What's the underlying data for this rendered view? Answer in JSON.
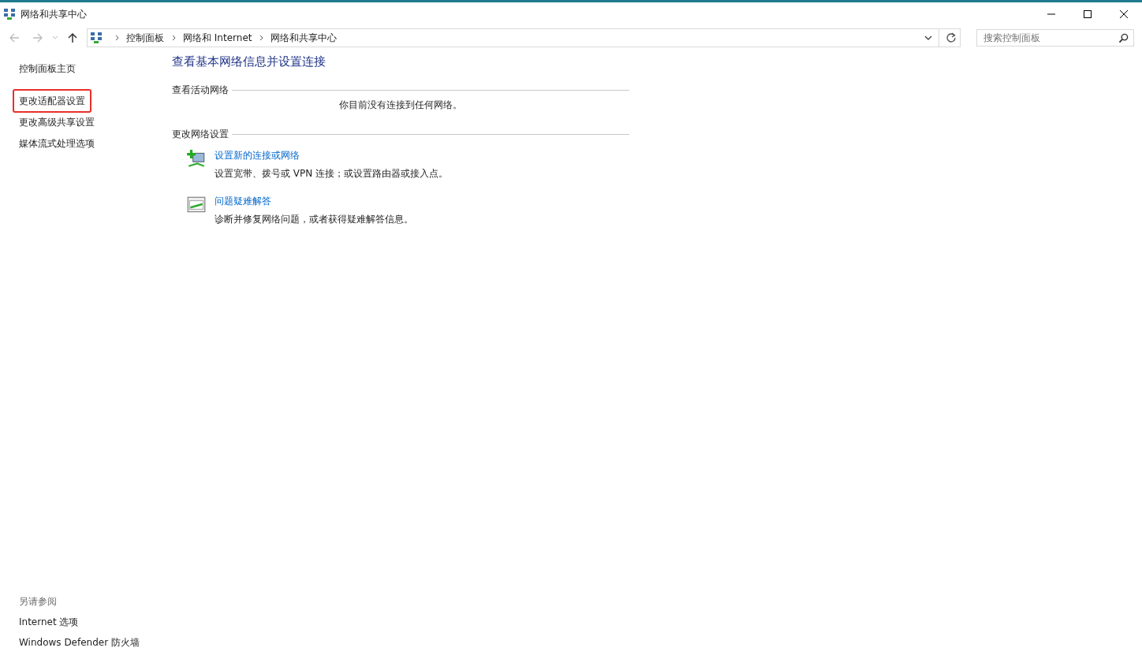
{
  "window": {
    "title": "网络和共享中心"
  },
  "address_bar": {
    "breadcrumbs": [
      "控制面板",
      "网络和 Internet",
      "网络和共享中心"
    ]
  },
  "search": {
    "placeholder": "搜索控制面板"
  },
  "sidebar": {
    "items": [
      {
        "label": "控制面板主页",
        "highlighted": false
      },
      {
        "label": "更改适配器设置",
        "highlighted": true
      },
      {
        "label": "更改高级共享设置",
        "highlighted": false
      },
      {
        "label": "媒体流式处理选项",
        "highlighted": false
      }
    ],
    "see_also": {
      "heading": "另请参阅",
      "links": [
        "Internet 选项",
        "Windows Defender 防火墙"
      ]
    }
  },
  "main": {
    "title": "查看基本网络信息并设置连接",
    "active_networks": {
      "heading": "查看活动网络",
      "message": "你目前没有连接到任何网络。"
    },
    "change_settings": {
      "heading": "更改网络设置",
      "tasks": [
        {
          "kind": "new-connection",
          "link": "设置新的连接或网络",
          "description": "设置宽带、拨号或 VPN 连接；或设置路由器或接入点。"
        },
        {
          "kind": "troubleshoot",
          "link": "问题疑难解答",
          "description": "诊断并修复网络问题，或者获得疑难解答信息。"
        }
      ]
    }
  }
}
